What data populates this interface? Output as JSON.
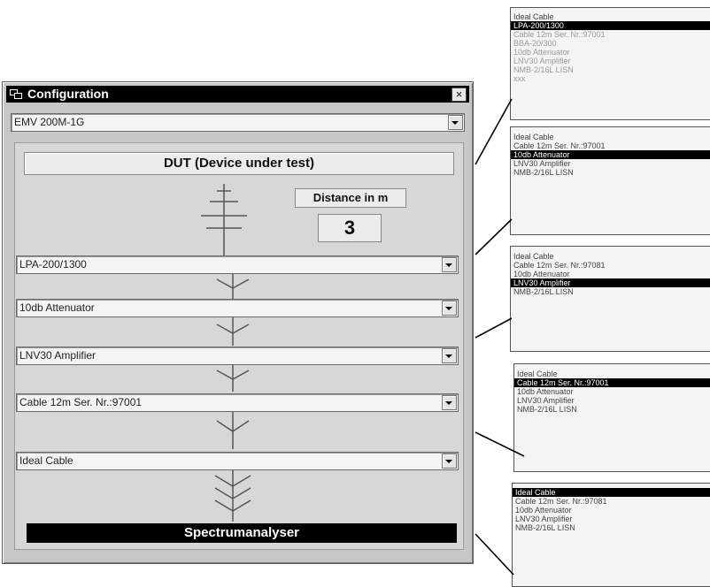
{
  "window": {
    "title": "Configuration",
    "close_glyph": "×"
  },
  "setup_select": {
    "value": "EMV 200M-1G"
  },
  "dut_label": "DUT (Device under test)",
  "distance": {
    "label": "Distance in m",
    "value": "3"
  },
  "chain": [
    {
      "value": "LPA-200/1300"
    },
    {
      "value": "10db Attenuator"
    },
    {
      "value": "LNV30 Amplifier"
    },
    {
      "value": "Cable 12m  Ser. Nr.:97001"
    },
    {
      "value": "Ideal Cable"
    }
  ],
  "sink_label": "Spectrumanalyser",
  "callouts": [
    {
      "items": [
        {
          "text": "Ideal Cable",
          "state": "normal"
        },
        {
          "text": "LPA-200/1300",
          "state": "selected"
        },
        {
          "text": "Cable 12m  Ser. Nr.:97001",
          "state": "grey"
        },
        {
          "text": "BBA-20/300",
          "state": "grey"
        },
        {
          "text": "10db Attenuator",
          "state": "grey"
        },
        {
          "text": "LNV30 Amplifier",
          "state": "grey"
        },
        {
          "text": "NMB-2/16L LISN",
          "state": "grey"
        },
        {
          "text": "xxx",
          "state": "grey"
        }
      ]
    },
    {
      "items": [
        {
          "text": "Ideal Cable",
          "state": "normal"
        },
        {
          "text": "Cable 12m  Ser. Nr.:97001",
          "state": "normal"
        },
        {
          "text": "10db Attenuator",
          "state": "selected"
        },
        {
          "text": "LNV30 Amplifier",
          "state": "normal"
        },
        {
          "text": "NMB-2/16L LISN",
          "state": "normal"
        }
      ]
    },
    {
      "items": [
        {
          "text": "Ideal Cable",
          "state": "normal"
        },
        {
          "text": "Cable 12m  Ser. Nr.:97081",
          "state": "normal"
        },
        {
          "text": "10db Attenuator",
          "state": "normal"
        },
        {
          "text": "LNV30 Amplifier",
          "state": "selected"
        },
        {
          "text": "NMB-2/16L LISN",
          "state": "normal"
        }
      ]
    },
    {
      "items": [
        {
          "text": "Ideal Cable",
          "state": "normal"
        },
        {
          "text": "Cable 12m  Ser. Nr.:97001",
          "state": "selected"
        },
        {
          "text": "10db Attenuator",
          "state": "normal"
        },
        {
          "text": "LNV30 Amplifier",
          "state": "normal"
        },
        {
          "text": "NMB-2/16L LISN",
          "state": "normal"
        }
      ]
    },
    {
      "items": [
        {
          "text": "Ideal Cable",
          "state": "selected"
        },
        {
          "text": "Cable 12m  Ser. Nr.:97081",
          "state": "normal"
        },
        {
          "text": "10db Attenuator",
          "state": "normal"
        },
        {
          "text": "LNV30 Amplifier",
          "state": "normal"
        },
        {
          "text": "NMB-2/16L LISN",
          "state": "normal"
        }
      ]
    }
  ]
}
